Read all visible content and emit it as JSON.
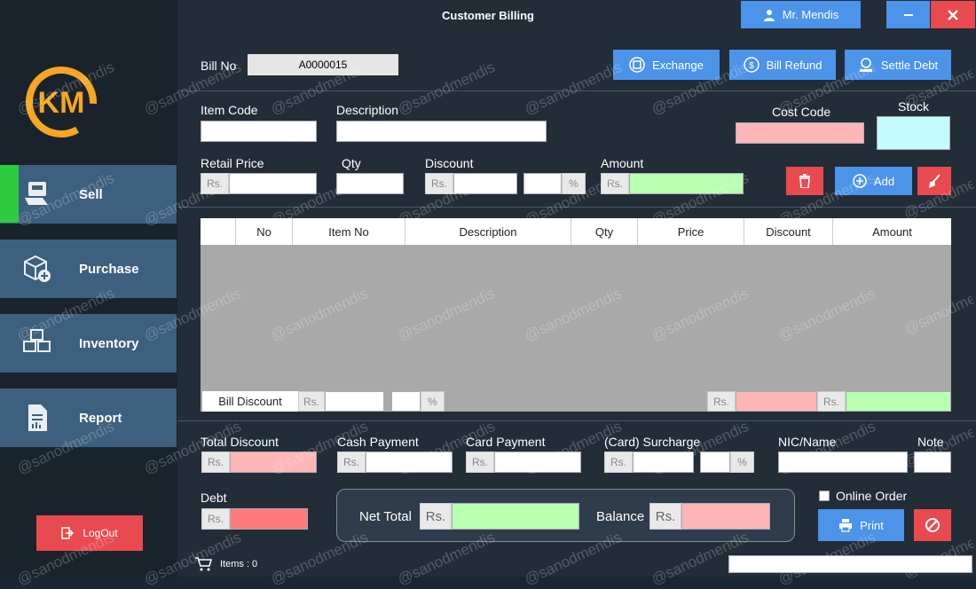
{
  "window": {
    "title": "Customer Billing",
    "user": "Mr. Mendis"
  },
  "sidebar": {
    "logo_text": "KM",
    "items": [
      {
        "label": "Sell"
      },
      {
        "label": "Purchase"
      },
      {
        "label": "Inventory"
      },
      {
        "label": "Report"
      }
    ],
    "logout_label": "LogOut"
  },
  "header": {
    "bill_no_label": "Bill No",
    "bill_no_value": "A0000015",
    "exchange_label": "Exchange",
    "refund_label": "Bill Refund",
    "settle_label": "Settle Debt"
  },
  "item_form": {
    "item_code_label": "Item Code",
    "description_label": "Description",
    "cost_code_label": "Cost Code",
    "stock_label": "Stock",
    "retail_price_label": "Retail Price",
    "qty_label": "Qty",
    "discount_label": "Discount",
    "amount_label": "Amount",
    "currency": "Rs.",
    "percent": "%",
    "add_label": "Add"
  },
  "table": {
    "columns": [
      "",
      "No",
      "Item No",
      "Description",
      "Qty",
      "Price",
      "Discount",
      "Amount"
    ],
    "rows": []
  },
  "bill_discount": {
    "label": "Bill Discount",
    "currency": "Rs.",
    "percent": "%"
  },
  "totals": {
    "total_discount_label": "Total Discount",
    "cash_payment_label": "Cash Payment",
    "card_payment_label": "Card Payment",
    "surcharge_label": "(Card) Surcharge",
    "nic_label": "NIC/Name",
    "note_label": "Note",
    "debt_label": "Debt",
    "net_total_label": "Net Total",
    "balance_label": "Balance",
    "online_order_label": "Online Order",
    "print_label": "Print",
    "currency": "Rs.",
    "percent": "%"
  },
  "status": {
    "items_label": "Items : 0"
  },
  "watermark": "@sanodmendis",
  "colors": {
    "sidebar_bg": "#1a232c",
    "main_bg": "#222d38",
    "nav_item": "#3d607f",
    "active_bar": "#2ecc40",
    "accent_blue": "#4c93ea",
    "accent_red": "#e84a4f",
    "pink_field": "#ffb6b6",
    "green_field": "#b8ffb0",
    "cyan_field": "#c4fbff",
    "table_body": "#a9a9a9",
    "logo_orange": "#f5a623"
  }
}
